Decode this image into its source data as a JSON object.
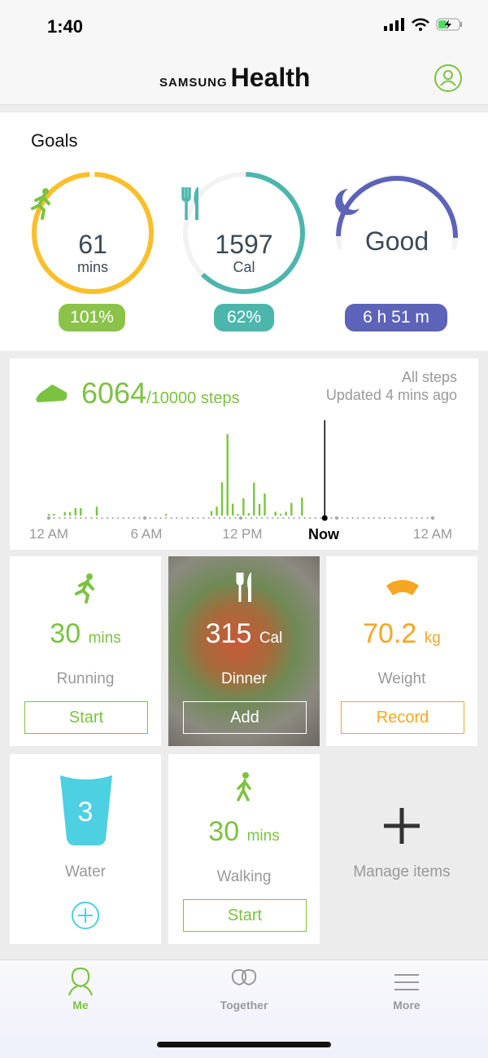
{
  "status_bar": {
    "time": "1:40"
  },
  "header": {
    "brand_small": "SAMSUNG",
    "brand_large": "Health",
    "profile_icon": "user-circle-icon"
  },
  "goals": {
    "title": "Goals",
    "activity": {
      "value": "61",
      "unit": "mins",
      "badge": "101%",
      "progress": 1.01,
      "color": "#fbbf2a",
      "badge_color": "#8bc34a"
    },
    "food": {
      "value": "1597",
      "unit": "Cal",
      "badge": "62%",
      "progress": 0.62,
      "color": "#4db6ac"
    },
    "sleep": {
      "value": "Good",
      "badge": "6 h  51 m",
      "color": "#5c63b8"
    }
  },
  "steps": {
    "count": "6064",
    "goal": "/10000 steps",
    "filter": "All steps",
    "updated": "Updated 4 mins ago",
    "chart_data": {
      "type": "bar",
      "x_ticks": [
        "12 AM",
        "6 AM",
        "12 PM",
        "Now",
        "12 AM"
      ],
      "now_hour": 17.25,
      "bars": [
        [
          0,
          5
        ],
        [
          0.33,
          5
        ],
        [
          1,
          12
        ],
        [
          1.33,
          12
        ],
        [
          1.67,
          25
        ],
        [
          2,
          25
        ],
        [
          3,
          30
        ],
        [
          7.33,
          5
        ],
        [
          10.17,
          15
        ],
        [
          10.5,
          30
        ],
        [
          10.83,
          113
        ],
        [
          11.17,
          277
        ],
        [
          11.5,
          40
        ],
        [
          11.83,
          5
        ],
        [
          12.17,
          59
        ],
        [
          12.5,
          8
        ],
        [
          12.83,
          112
        ],
        [
          13.17,
          40
        ],
        [
          13.5,
          75
        ],
        [
          14.17,
          13
        ],
        [
          14.5,
          5
        ],
        [
          14.83,
          13
        ],
        [
          15.17,
          43
        ],
        [
          15.83,
          61
        ]
      ],
      "color": "#7cc242"
    }
  },
  "tiles": {
    "running": {
      "value": "30",
      "unit": "mins",
      "label": "Running",
      "button": "Start"
    },
    "food": {
      "value": "315",
      "unit": "Cal",
      "label": "Dinner",
      "button": "Add"
    },
    "weight": {
      "value": "70.2",
      "unit": "kg",
      "label": "Weight",
      "button": "Record"
    },
    "water": {
      "value": "3",
      "label": "Water"
    },
    "walking": {
      "value": "30",
      "unit": "mins",
      "label": "Walking",
      "button": "Start"
    },
    "manage": {
      "label": "Manage items"
    }
  },
  "tabs": [
    {
      "label": "Me",
      "active": true
    },
    {
      "label": "Together"
    },
    {
      "label": "More"
    }
  ]
}
